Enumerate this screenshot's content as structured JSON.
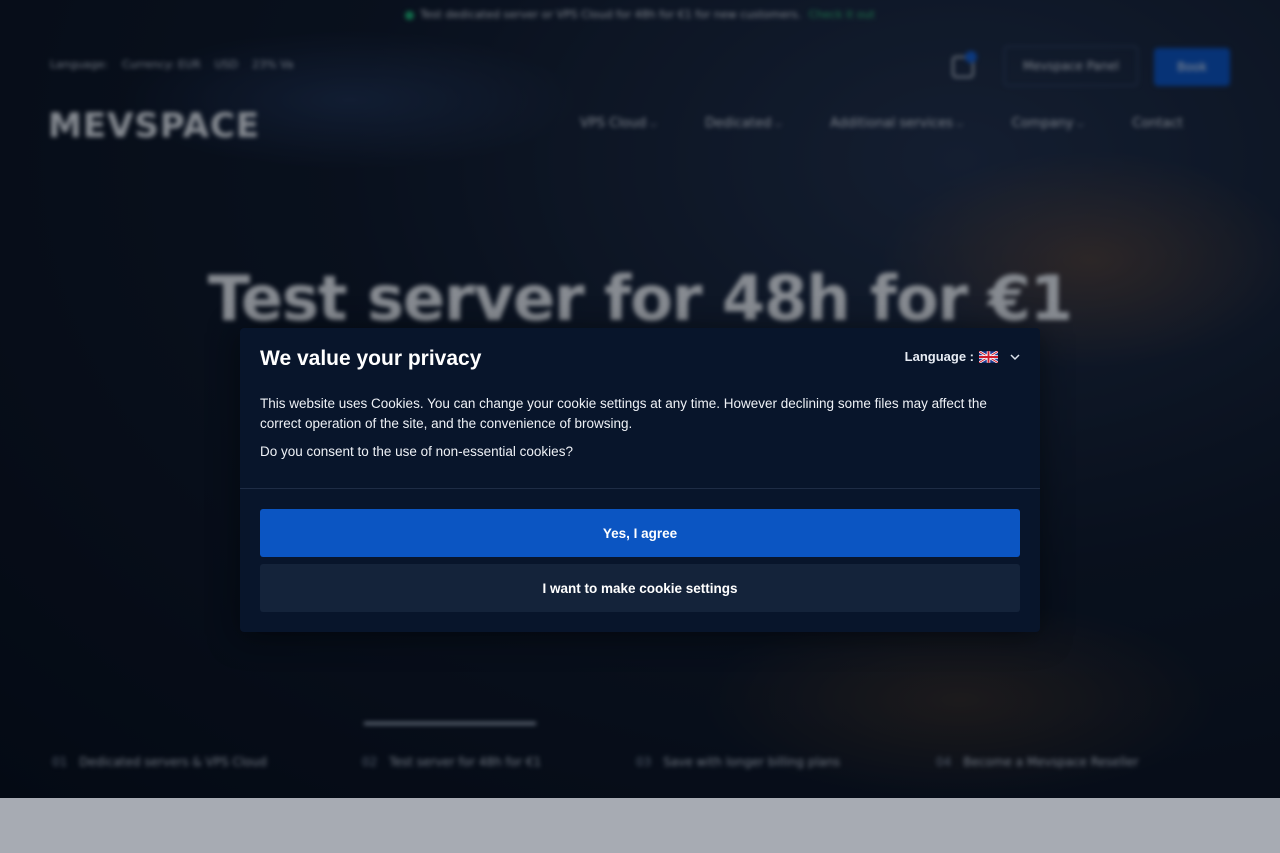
{
  "background_page": {
    "announcement": {
      "text": "Test dedicated server or VPS Cloud for 48h for €1 for new customers.",
      "link": "Check it out"
    },
    "meta": {
      "language_label": "Language:",
      "currency_label": "Currency: EUR",
      "currency_alt": "USD",
      "vat": "23% Va"
    },
    "header": {
      "logo": "MEVSPACE",
      "panel_button": "Mevspace Panel",
      "book_button": "Book"
    },
    "nav": [
      "VPS Cloud",
      "Dedicated",
      "Additional services",
      "Company",
      "Contact"
    ],
    "hero_title": "Test server for 48h for €1",
    "slides": [
      {
        "num": "01",
        "label": "Dedicated servers & VPS Cloud"
      },
      {
        "num": "02",
        "label": "Test server for 48h for €1"
      },
      {
        "num": "03",
        "label": "Save with longer billing plans"
      },
      {
        "num": "04",
        "label": "Become a Mevspace Reseller"
      }
    ]
  },
  "cookie_modal": {
    "title": "We value your privacy",
    "language_label": "Language :",
    "flag_icon": "uk-flag-icon",
    "body_text": "This website uses Cookies. You can change your cookie settings at any time. However declining some files may affect the correct operation of the site, and the convenience of browsing.",
    "question": "Do you consent to the use of non-essential cookies?",
    "agree_button": "Yes, I agree",
    "settings_button": "I want to make cookie settings"
  },
  "colors": {
    "modal_bg": "#08152b",
    "primary": "#0b55c2",
    "secondary_button": "#14233a",
    "footer_strip": "#a7abb3"
  }
}
